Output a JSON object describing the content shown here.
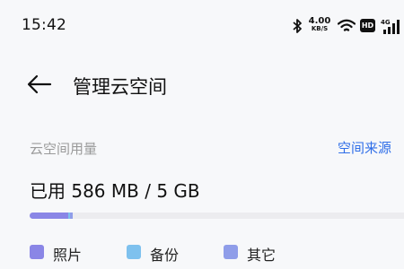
{
  "status_bar": {
    "time": "15:42",
    "net_speed_value": "4.00",
    "net_speed_unit": "KB/S",
    "hd_badge": "HD",
    "network_type": "4G",
    "icons": [
      "bluetooth-icon",
      "wifi-icon",
      "hd-icon",
      "signal-icon"
    ]
  },
  "header": {
    "back_icon": "arrow-left-icon",
    "title": "管理云空间"
  },
  "storage": {
    "section_label": "云空间用量",
    "source_link": "空间来源",
    "usage_text": "已用 586 MB / 5 GB",
    "used_fraction": 0.114,
    "segments": [
      {
        "label": "照片",
        "color": "#8a86e6",
        "fraction": 0.102
      },
      {
        "label": "备份",
        "color": "#7ec1ee",
        "fraction": 0.004
      },
      {
        "label": "其它",
        "color": "#8f9de9",
        "fraction": 0.008
      }
    ],
    "track_color": "#ececef"
  },
  "legend": [
    {
      "label": "照片",
      "color": "#8a86e6"
    },
    {
      "label": "备份",
      "color": "#7ec1ee"
    },
    {
      "label": "其它",
      "color": "#8f9de9"
    }
  ],
  "colors": {
    "accent": "#2f6ee8",
    "background": "#f7f8fa",
    "muted_text": "#9a9a9a"
  }
}
